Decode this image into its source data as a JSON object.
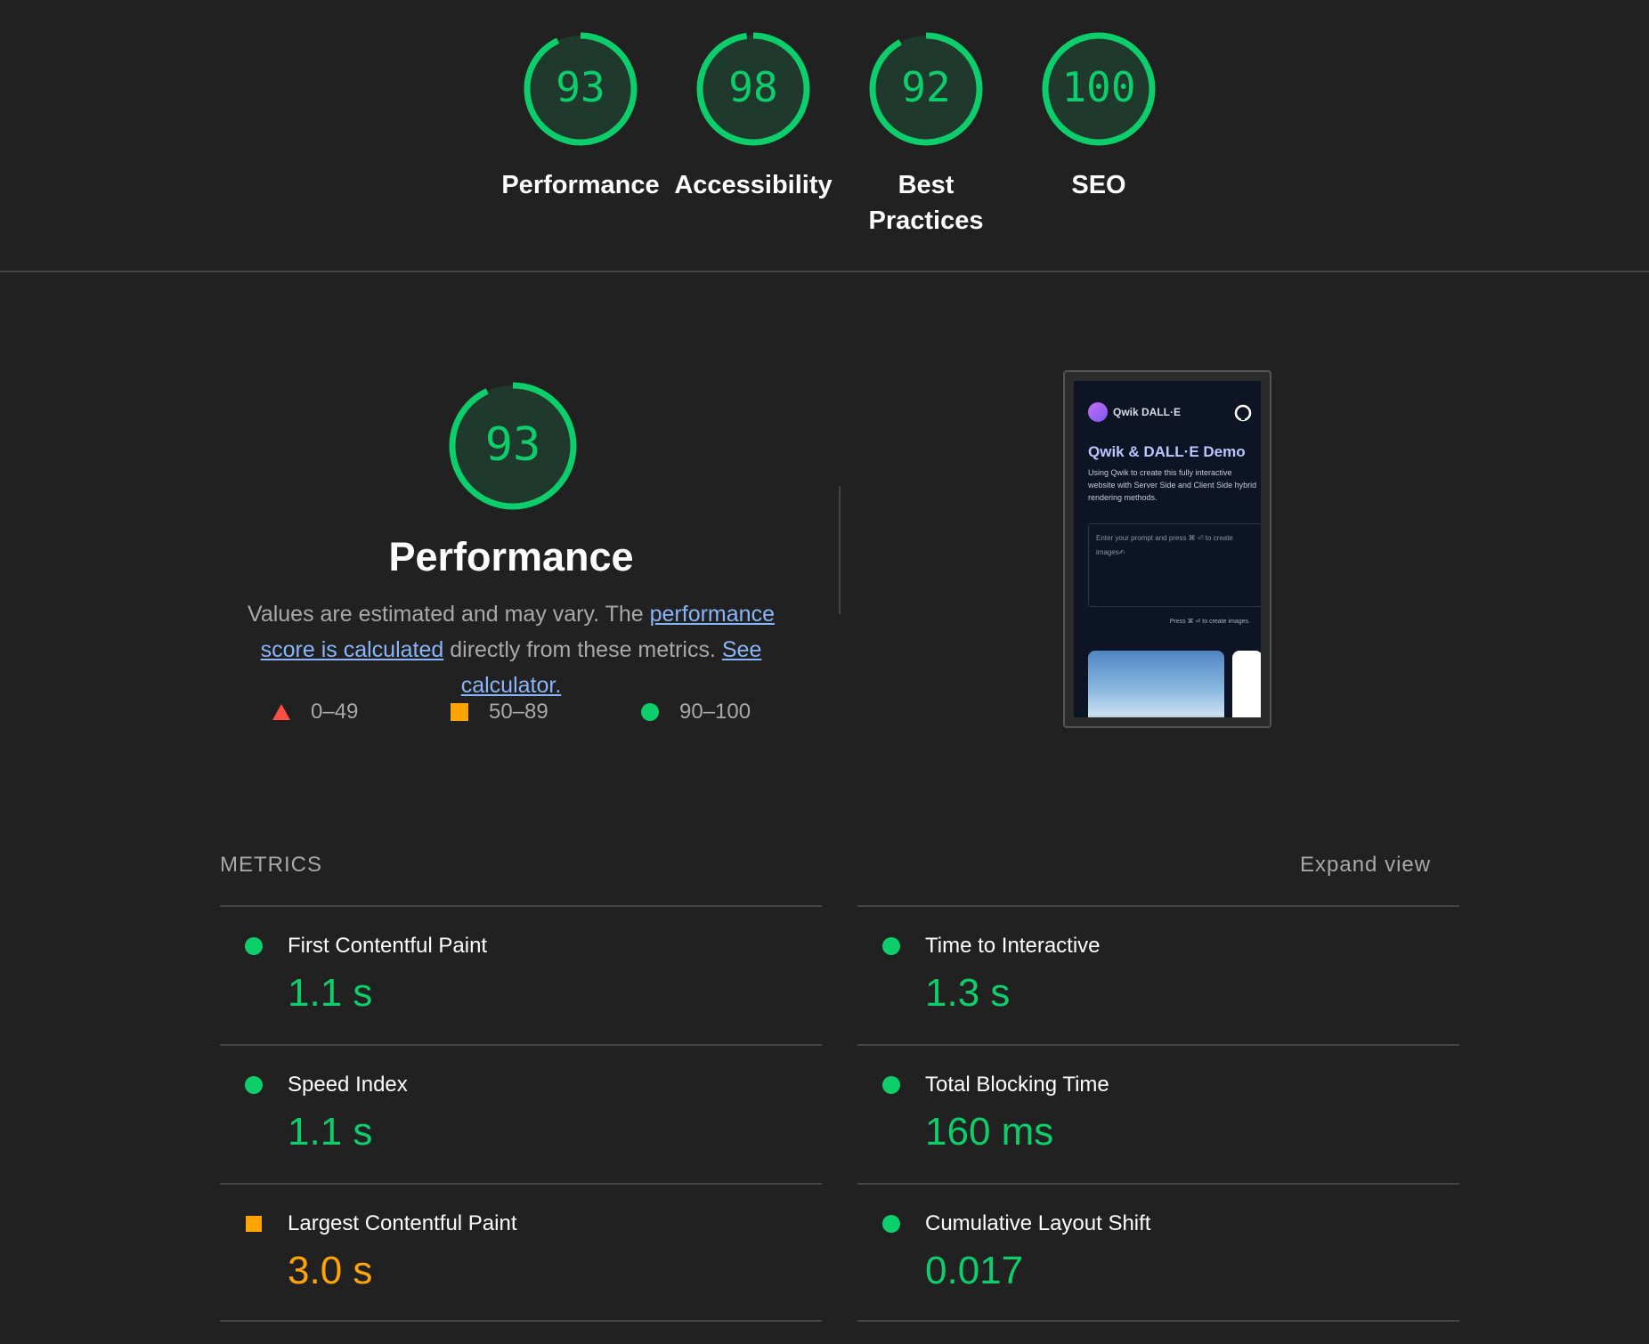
{
  "colors": {
    "background": "#212121",
    "good": "#0cce6b",
    "average": "#ffa400",
    "fail": "#ff4e42",
    "link": "#8ab4f8",
    "divider": "#444444"
  },
  "categories": [
    {
      "score": "93",
      "score_value": 93,
      "label": "Performance"
    },
    {
      "score": "98",
      "score_value": 98,
      "label": "Accessibility"
    },
    {
      "score": "92",
      "score_value": 92,
      "label": "Best Practices",
      "label_line1": "Best",
      "label_line2": "Practices"
    },
    {
      "score": "100",
      "score_value": 100,
      "label": "SEO"
    }
  ],
  "performance": {
    "score": "93",
    "score_value": 93,
    "title": "Performance",
    "desc_part1": "Values are estimated and may vary. The ",
    "desc_link1": "performance score is calculated",
    "desc_part2": " directly from these metrics. ",
    "desc_link2": "See calculator."
  },
  "legend": [
    {
      "shape": "triangle-icon",
      "range": "0–49",
      "color": "#ff4e42"
    },
    {
      "shape": "square-icon",
      "range": "50–89",
      "color": "#ffa400"
    },
    {
      "shape": "circle-icon",
      "range": "90–100",
      "color": "#0cce6b"
    }
  ],
  "screenshot": {
    "brand": "Qwik DALL·E",
    "heading": "Qwik & DALL·E Demo",
    "paragraph": "Using Qwik to create this fully interactive website with Server Side and Client Side hybrid rendering methods.",
    "input_placeholder": "Enter your prompt and press ⌘ ⏎ to create images✍",
    "hint": "Press ⌘ ⏎ to create images."
  },
  "metrics": {
    "title": "METRICS",
    "expand": "Expand view",
    "items": [
      {
        "name": "First Contentful Paint",
        "value": "1.1 s",
        "rating": "good"
      },
      {
        "name": "Time to Interactive",
        "value": "1.3 s",
        "rating": "good"
      },
      {
        "name": "Speed Index",
        "value": "1.1 s",
        "rating": "good"
      },
      {
        "name": "Total Blocking Time",
        "value": "160 ms",
        "rating": "good"
      },
      {
        "name": "Largest Contentful Paint",
        "value": "3.0 s",
        "rating": "average"
      },
      {
        "name": "Cumulative Layout Shift",
        "value": "0.017",
        "rating": "good"
      }
    ]
  }
}
